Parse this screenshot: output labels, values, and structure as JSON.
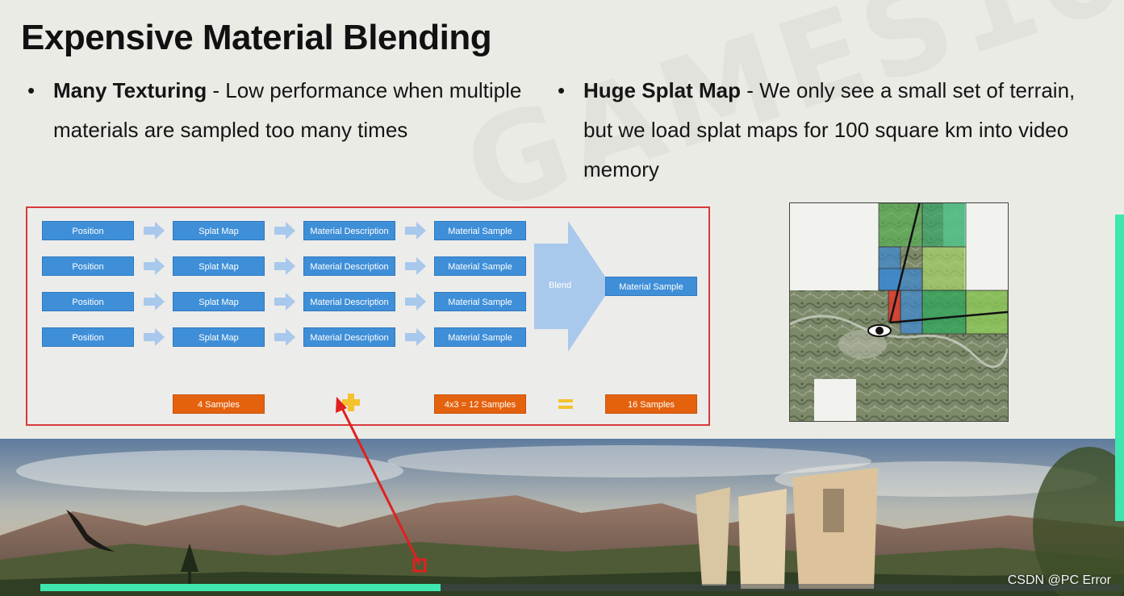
{
  "slide": {
    "title": "Expensive Material Blending",
    "bullets": [
      {
        "marker": "•",
        "heading": "Many Texturing",
        "text": " - Low performance when multiple materials are sampled too many times"
      },
      {
        "marker": "•",
        "heading": "Huge Splat Map",
        "text": " - We only see a small set of terrain, but we load splat maps for 100 square km into video memory"
      }
    ]
  },
  "diagram": {
    "rows": [
      [
        "Position",
        "Splat Map",
        "Material Description",
        "Material Sample"
      ],
      [
        "Position",
        "Splat Map",
        "Material Description",
        "Material Sample"
      ],
      [
        "Position",
        "Splat Map",
        "Material Description",
        "Material Sample"
      ],
      [
        "Position",
        "Splat Map",
        "Material Description",
        "Material Sample"
      ]
    ],
    "blend_label": "Blend",
    "output_label": "Material Sample",
    "samples": {
      "left": "4 Samples",
      "middle": "4x3 = 12 Samples",
      "total": "16 Samples"
    },
    "colors": {
      "box": "#3f8fd8",
      "arrow": "#a8c8ec",
      "sample": "#e4620e",
      "plus": "#f5c22e"
    }
  },
  "map": {
    "colors": {
      "green": "#59b556",
      "light_green": "#a8d66a",
      "blue": "#3f88cc",
      "red": "#e03a2a"
    },
    "icons": [
      "eye-icon"
    ]
  },
  "footer": {
    "credit": "CSDN @PC Error",
    "progress": 0.37,
    "accent": "#3fe6ae"
  }
}
